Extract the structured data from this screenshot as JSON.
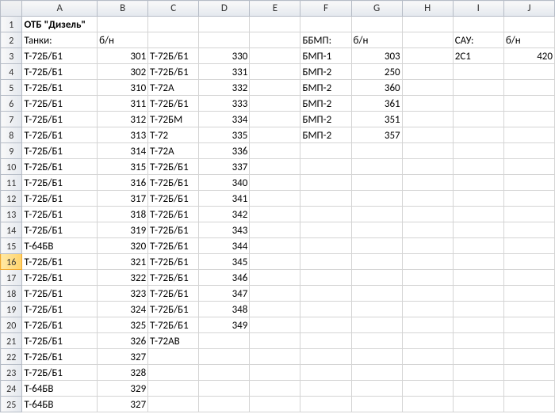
{
  "columns": [
    "A",
    "B",
    "C",
    "D",
    "E",
    "F",
    "G",
    "H",
    "I",
    "J"
  ],
  "rows": 25,
  "selected_row": 16,
  "cells": {
    "A1": {
      "v": "ОТБ \"Дизель\"",
      "bold": true
    },
    "A2": {
      "v": "Танки:"
    },
    "B2": {
      "v": "б/н"
    },
    "F2": {
      "v": "ББМП:"
    },
    "G2": {
      "v": "б/н"
    },
    "I2": {
      "v": "САУ:"
    },
    "J2": {
      "v": "б/н"
    },
    "A3": {
      "v": "Т-72Б/Б1"
    },
    "B3": {
      "v": "301",
      "n": true
    },
    "C3": {
      "v": "Т-72Б/Б1"
    },
    "D3": {
      "v": "330",
      "n": true
    },
    "F3": {
      "v": "БМП-1"
    },
    "G3": {
      "v": "303",
      "n": true
    },
    "I3": {
      "v": "2С1"
    },
    "J3": {
      "v": "420",
      "n": true
    },
    "A4": {
      "v": "Т-72Б/Б1"
    },
    "B4": {
      "v": "302",
      "n": true
    },
    "C4": {
      "v": "Т-72Б/Б1"
    },
    "D4": {
      "v": "331",
      "n": true
    },
    "F4": {
      "v": "БМП-2"
    },
    "G4": {
      "v": "250",
      "n": true
    },
    "A5": {
      "v": "Т-72Б/Б1"
    },
    "B5": {
      "v": "310",
      "n": true
    },
    "C5": {
      "v": "Т-72А"
    },
    "D5": {
      "v": "332",
      "n": true
    },
    "F5": {
      "v": "БМП-2"
    },
    "G5": {
      "v": "360",
      "n": true
    },
    "A6": {
      "v": "Т-72Б/Б1"
    },
    "B6": {
      "v": "311",
      "n": true
    },
    "C6": {
      "v": "Т-72Б/Б1"
    },
    "D6": {
      "v": "333",
      "n": true
    },
    "F6": {
      "v": "БМП-2"
    },
    "G6": {
      "v": "361",
      "n": true
    },
    "A7": {
      "v": "Т-72Б/Б1"
    },
    "B7": {
      "v": "312",
      "n": true
    },
    "C7": {
      "v": "Т-72БМ"
    },
    "D7": {
      "v": "334",
      "n": true
    },
    "F7": {
      "v": "БМП-2"
    },
    "G7": {
      "v": "351",
      "n": true
    },
    "A8": {
      "v": "Т-72Б/Б1"
    },
    "B8": {
      "v": "313",
      "n": true
    },
    "C8": {
      "v": "Т-72"
    },
    "D8": {
      "v": "335",
      "n": true
    },
    "F8": {
      "v": "БМП-2"
    },
    "G8": {
      "v": "357",
      "n": true
    },
    "A9": {
      "v": "Т-72Б/Б1"
    },
    "B9": {
      "v": "314",
      "n": true
    },
    "C9": {
      "v": "Т-72А"
    },
    "D9": {
      "v": "336",
      "n": true
    },
    "A10": {
      "v": "Т-72Б/Б1"
    },
    "B10": {
      "v": "315",
      "n": true
    },
    "C10": {
      "v": "Т-72Б/Б1"
    },
    "D10": {
      "v": "337",
      "n": true
    },
    "A11": {
      "v": "Т-72Б/Б1"
    },
    "B11": {
      "v": "316",
      "n": true
    },
    "C11": {
      "v": "Т-72Б/Б1"
    },
    "D11": {
      "v": "340",
      "n": true
    },
    "A12": {
      "v": "Т-72Б/Б1"
    },
    "B12": {
      "v": "317",
      "n": true
    },
    "C12": {
      "v": "Т-72Б/Б1"
    },
    "D12": {
      "v": "341",
      "n": true
    },
    "A13": {
      "v": "Т-72Б/Б1"
    },
    "B13": {
      "v": "318",
      "n": true
    },
    "C13": {
      "v": "Т-72Б/Б1"
    },
    "D13": {
      "v": "342",
      "n": true
    },
    "A14": {
      "v": "Т-72Б/Б1"
    },
    "B14": {
      "v": "319",
      "n": true
    },
    "C14": {
      "v": "Т-72Б/Б1"
    },
    "D14": {
      "v": "343",
      "n": true
    },
    "A15": {
      "v": "Т-64БВ"
    },
    "B15": {
      "v": "320",
      "n": true
    },
    "C15": {
      "v": "Т-72Б/Б1"
    },
    "D15": {
      "v": "344",
      "n": true
    },
    "A16": {
      "v": "Т-72Б/Б1"
    },
    "B16": {
      "v": "321",
      "n": true
    },
    "C16": {
      "v": "Т-72Б/Б1"
    },
    "D16": {
      "v": "345",
      "n": true
    },
    "A17": {
      "v": "Т-72Б/Б1"
    },
    "B17": {
      "v": "322",
      "n": true
    },
    "C17": {
      "v": "Т-72Б/Б1"
    },
    "D17": {
      "v": "346",
      "n": true
    },
    "A18": {
      "v": "Т-72Б/Б1"
    },
    "B18": {
      "v": "323",
      "n": true
    },
    "C18": {
      "v": "Т-72Б/Б1"
    },
    "D18": {
      "v": "347",
      "n": true
    },
    "A19": {
      "v": "Т-72Б/Б1"
    },
    "B19": {
      "v": "324",
      "n": true
    },
    "C19": {
      "v": "Т-72Б/Б1"
    },
    "D19": {
      "v": "348",
      "n": true
    },
    "A20": {
      "v": "Т-72Б/Б1"
    },
    "B20": {
      "v": "325",
      "n": true
    },
    "C20": {
      "v": "Т-72Б/Б1"
    },
    "D20": {
      "v": "349",
      "n": true
    },
    "A21": {
      "v": "Т-72Б/Б1"
    },
    "B21": {
      "v": "326",
      "n": true
    },
    "C21": {
      "v": "Т-72АВ"
    },
    "A22": {
      "v": "Т-72Б/Б1"
    },
    "B22": {
      "v": "327",
      "n": true
    },
    "A23": {
      "v": "Т-72Б/Б1"
    },
    "B23": {
      "v": "328",
      "n": true
    },
    "A24": {
      "v": "Т-64БВ"
    },
    "B24": {
      "v": "329",
      "n": true
    },
    "A25": {
      "v": "Т-64БВ"
    },
    "B25": {
      "v": "327",
      "n": true
    }
  }
}
